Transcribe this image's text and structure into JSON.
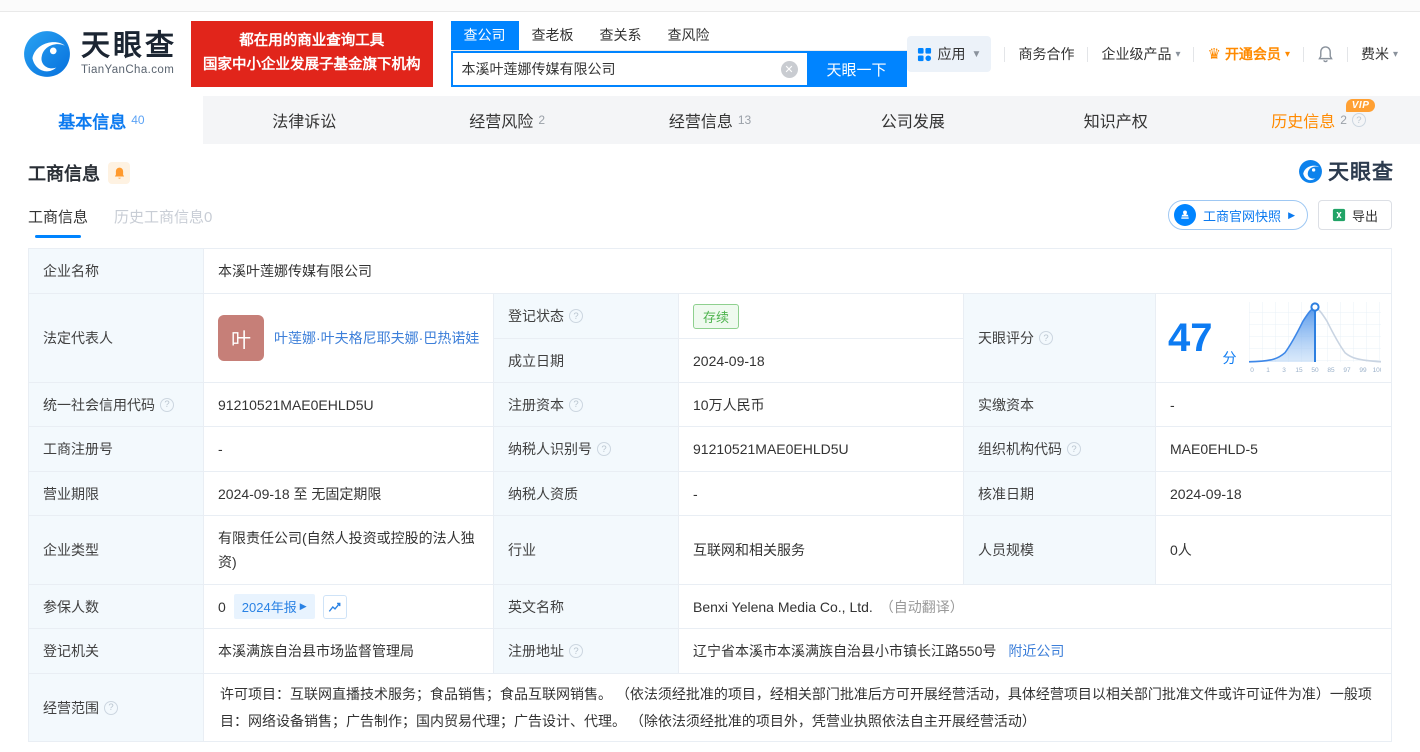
{
  "brand": {
    "name": "天眼查",
    "domain": "TianYanCha.com",
    "slogan_line1": "都在用的商业查询工具",
    "slogan_line2": "国家中小企业发展子基金旗下机构",
    "accent_color": "#0084ff",
    "slogan_bg_color": "#e1251b"
  },
  "search": {
    "tabs": [
      {
        "label": "查公司",
        "active": true
      },
      {
        "label": "查老板",
        "active": false
      },
      {
        "label": "查关系",
        "active": false
      },
      {
        "label": "查风险",
        "active": false
      }
    ],
    "value": "本溪叶莲娜传媒有限公司",
    "button_label": "天眼一下"
  },
  "top_nav": {
    "apps_label": "应用",
    "cooperation_label": "商务合作",
    "enterprise_label": "企业级产品",
    "vip_label": "开通会员",
    "username": "费米"
  },
  "tabs": [
    {
      "label": "基本信息",
      "count": "40",
      "active": true
    },
    {
      "label": "法律诉讼",
      "count": "",
      "active": false
    },
    {
      "label": "经营风险",
      "count": "2",
      "active": false
    },
    {
      "label": "经营信息",
      "count": "13",
      "active": false
    },
    {
      "label": "公司发展",
      "count": "",
      "active": false
    },
    {
      "label": "知识产权",
      "count": "",
      "active": false
    },
    {
      "label": "历史信息",
      "count": "2",
      "active": false,
      "vip": true
    }
  ],
  "section": {
    "title": "工商信息",
    "watermark": "天眼查",
    "subtab_active": "工商信息",
    "subtab_inactive": "历史工商信息0",
    "snapshot_button": "工商官网快照",
    "export_button": "导出"
  },
  "info": {
    "company_name": {
      "label": "企业名称",
      "value": "本溪叶莲娜传媒有限公司"
    },
    "legal_rep": {
      "label": "法定代表人",
      "avatar": "叶",
      "name": "叶莲娜·叶夫格尼耶夫娜·巴热诺娃"
    },
    "reg_status": {
      "label": "登记状态",
      "value": "存续"
    },
    "establish_date": {
      "label": "成立日期",
      "value": "2024-09-18"
    },
    "score": {
      "label": "天眼评分",
      "value": "47",
      "unit": "分"
    },
    "credit_code": {
      "label": "统一社会信用代码",
      "value": "91210521MAE0EHLD5U"
    },
    "reg_capital": {
      "label": "注册资本",
      "value": "10万人民币"
    },
    "paid_capital": {
      "label": "实缴资本",
      "value": "-"
    },
    "reg_number": {
      "label": "工商注册号",
      "value": "-"
    },
    "taxpayer_id": {
      "label": "纳税人识别号",
      "value": "91210521MAE0EHLD5U"
    },
    "org_code": {
      "label": "组织机构代码",
      "value": "MAE0EHLD-5"
    },
    "business_term": {
      "label": "营业期限",
      "value": "2024-09-18 至 无固定期限"
    },
    "taxpayer_quality": {
      "label": "纳税人资质",
      "value": "-"
    },
    "approval_date": {
      "label": "核准日期",
      "value": "2024-09-18"
    },
    "company_type": {
      "label": "企业类型",
      "value": "有限责任公司(自然人投资或控股的法人独资)"
    },
    "industry": {
      "label": "行业",
      "value": "互联网和相关服务"
    },
    "staff_size": {
      "label": "人员规模",
      "value": "0人"
    },
    "insured_count": {
      "label": "参保人数",
      "value": "0",
      "report_badge": "2024年报"
    },
    "english_name": {
      "label": "英文名称",
      "value": "Benxi Yelena Media Co., Ltd.",
      "note": "（自动翻译）"
    },
    "registry_authority": {
      "label": "登记机关",
      "value": "本溪满族自治县市场监督管理局"
    },
    "address": {
      "label": "注册地址",
      "value": "辽宁省本溪市本溪满族自治县小市镇长江路550号",
      "link": "附近公司"
    },
    "business_scope": {
      "label": "经营范围",
      "value": "许可项目：互联网直播技术服务；食品销售；食品互联网销售。 （依法须经批准的项目，经相关部门批准后方可开展经营活动，具体经营项目以相关部门批准文件或许可证件为准）一般项目：网络设备销售；广告制作；国内贸易代理；广告设计、代理。 （除依法须经批准的项目外，凭营业执照依法自主开展经营活动）"
    }
  },
  "chart_data": {
    "type": "area",
    "title": "天眼评分分布曲线",
    "score": 47,
    "marker_percentile_tick": "50",
    "x_ticks": [
      "0",
      "1",
      "3",
      "15",
      "50",
      "85",
      "97",
      "99",
      "100"
    ],
    "curve": "normal-distribution, filled blue left of marker at tick 50",
    "fill_color": "#4e93ea",
    "line_color": "#c9d4e2",
    "grid": true,
    "legend": false
  }
}
